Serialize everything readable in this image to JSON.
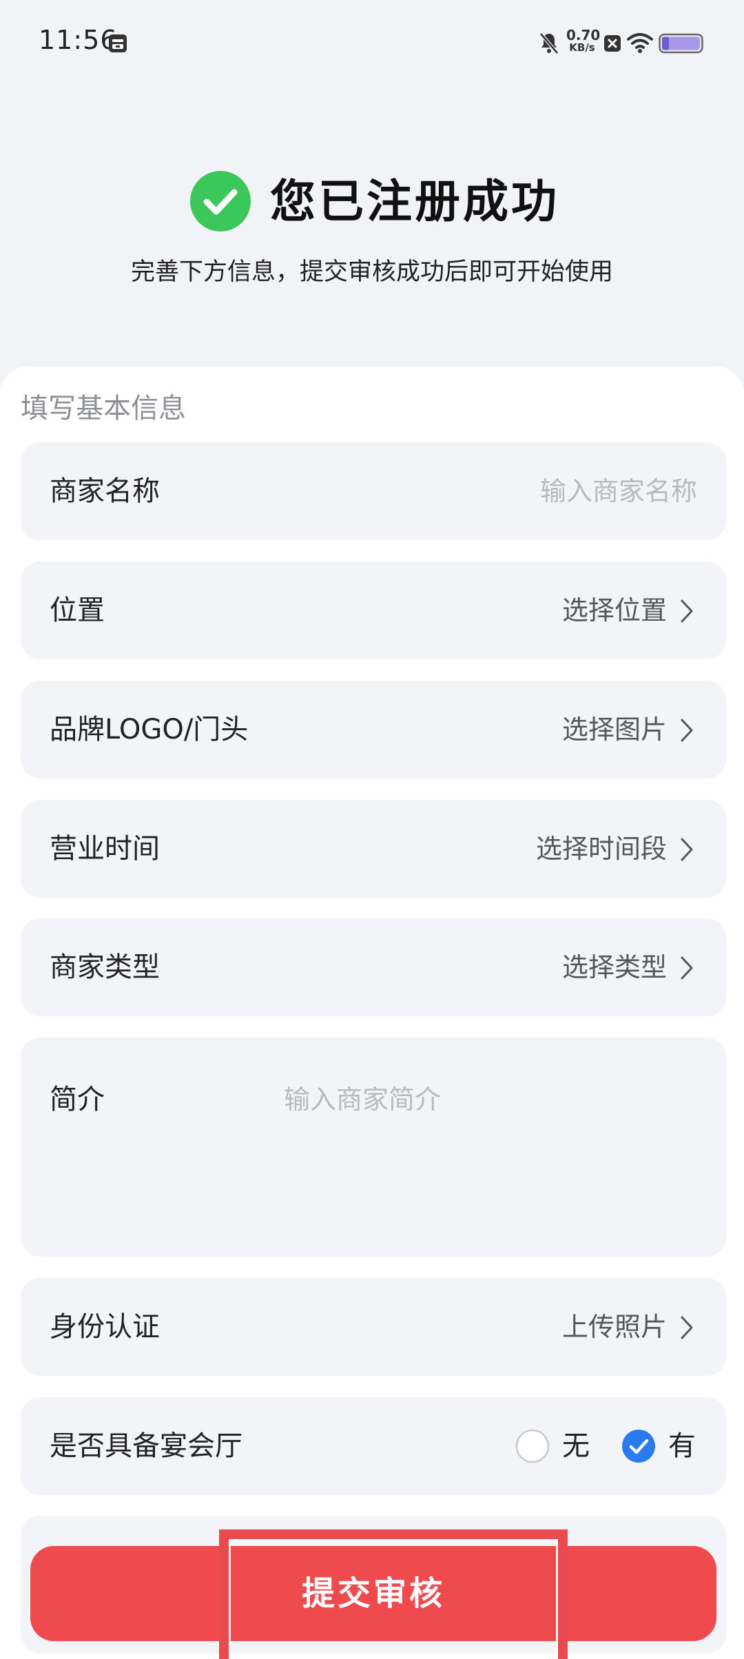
{
  "status_bar": {
    "time": "11:56",
    "net_speed_value": "0.70",
    "net_speed_unit": "KB/s",
    "icons": [
      "sim-card-icon",
      "bell-muted-icon",
      "close-box-icon",
      "wifi-icon",
      "battery-icon"
    ]
  },
  "header": {
    "title": "您已注册成功",
    "subtitle": "完善下方信息，提交审核成功后即可开始使用",
    "check_color": "#3cc75a"
  },
  "form": {
    "section_title": "填写基本信息",
    "fields": [
      {
        "label": "商家名称",
        "placeholder": "输入商家名称"
      },
      {
        "label": "位置",
        "value": "选择位置"
      },
      {
        "label": "品牌LOGO/门头",
        "value": "选择图片"
      },
      {
        "label": "营业时间",
        "value": "选择时间段"
      },
      {
        "label": "商家类型",
        "value": "选择类型"
      },
      {
        "label": "简介",
        "placeholder": "输入商家简介"
      },
      {
        "label": "身份认证",
        "value": "上传照片"
      }
    ],
    "banquet": {
      "label": "是否具备宴会厅",
      "options": [
        {
          "label": "无",
          "selected": false
        },
        {
          "label": "有",
          "selected": true
        }
      ],
      "selected_color": "#2a7bf0"
    }
  },
  "submit": {
    "label": "提交审核",
    "color": "#ef4a4e"
  }
}
